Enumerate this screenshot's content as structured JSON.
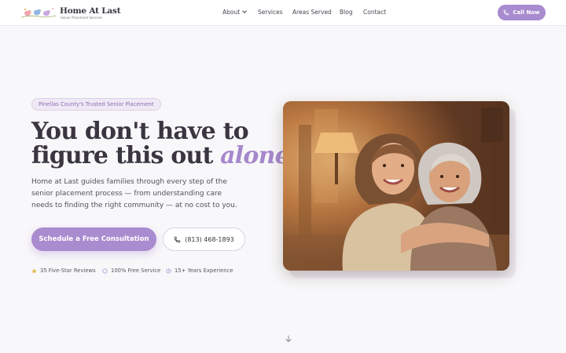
{
  "header": {
    "logo_title": "Home At Last",
    "logo_subtitle": "Senior Placement Services",
    "nav": {
      "about": "About",
      "services": "Services",
      "areas": "Areas Served",
      "blog": "Blog",
      "contact": "Contact"
    },
    "call_label": "Call Now"
  },
  "hero": {
    "badge": "Pinellas County's Trusted Senior Placement",
    "headline_line1": "You don't have to",
    "headline_line2": "figure this out",
    "headline_accent": "alone.",
    "lede": "Home at Last guides families through every step of the senior placement process — from understanding care needs to finding the right community — at no cost to you.",
    "cta_primary": "Schedule a Free Consultation",
    "cta_phone": "(813) 468-1893",
    "trust": [
      "35 Five-Star Reviews",
      "100% Free Service",
      "15+ Years Experience"
    ]
  },
  "colors": {
    "accent": "#a98bcf",
    "accent_text": "#a688cc",
    "star": "#e0b33a",
    "background": "#f8f7f9"
  },
  "icons": {
    "call": "phone-icon",
    "star": "star-icon",
    "free": "circle-icon",
    "experience": "clock-icon",
    "scroll": "arrow-down-icon"
  }
}
